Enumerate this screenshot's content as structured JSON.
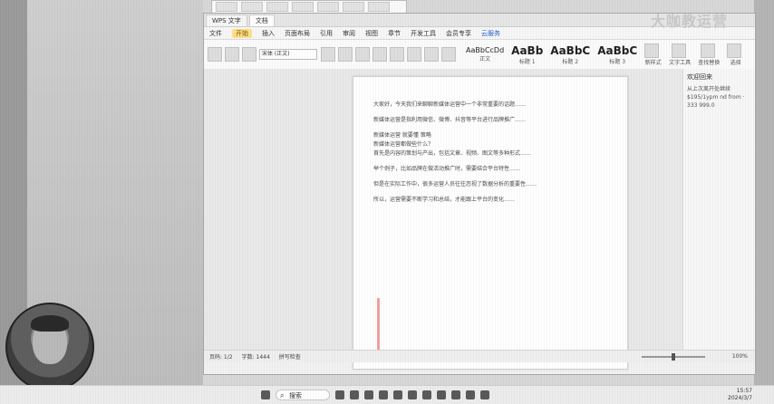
{
  "window": {
    "tabs": [
      "WPS 文字",
      "文档"
    ],
    "brand": "大咖教运营"
  },
  "menu": [
    "文件",
    "开始",
    "插入",
    "页面布局",
    "引用",
    "审阅",
    "视图",
    "章节",
    "开发工具",
    "会员专享",
    "云服务"
  ],
  "menu_active": "开始",
  "ribbon": {
    "font_name": "宋体 (正文)",
    "styles": [
      {
        "sample": "AaBbCcDd",
        "label": "正文"
      },
      {
        "sample": "AaBb",
        "label": "标题 1"
      },
      {
        "sample": "AaBbC",
        "label": "标题 2"
      },
      {
        "sample": "AaBbC",
        "label": "标题 3"
      }
    ],
    "right_items": [
      "新样式",
      "文字工具",
      "查找替换",
      "选择"
    ]
  },
  "document": {
    "paragraphs": [
      "大家好，今天我们来聊聊新媒体运营中一个非常重要的话题……",
      "新媒体运营是指利用微信、微博、抖音等平台进行品牌推广……",
      "新媒体运营 就要懂 策略",
      "新媒体运营都做些什么？",
      "首先是内容的策划与产出，包括文章、视频、图文等多种形式……",
      "举个例子，比如品牌在做活动推广时，需要结合平台特性……",
      "但是在实际工作中，很多运营人员往往忽视了数据分析的重要性……",
      "所以，运营需要不断学习和总结，才能跟上平台的变化……"
    ]
  },
  "sidepanel": {
    "title": "欢迎回来",
    "items": [
      "从上次离开处继续",
      "$195/1ypm nd from · 333 999.0"
    ]
  },
  "status": {
    "page": "页码: 1/2",
    "words": "字数: 1444",
    "check": "拼写检查",
    "zoom": "100%"
  },
  "taskbar": {
    "search_label": "搜索",
    "time": "15:57",
    "date": "2024/3/7"
  }
}
